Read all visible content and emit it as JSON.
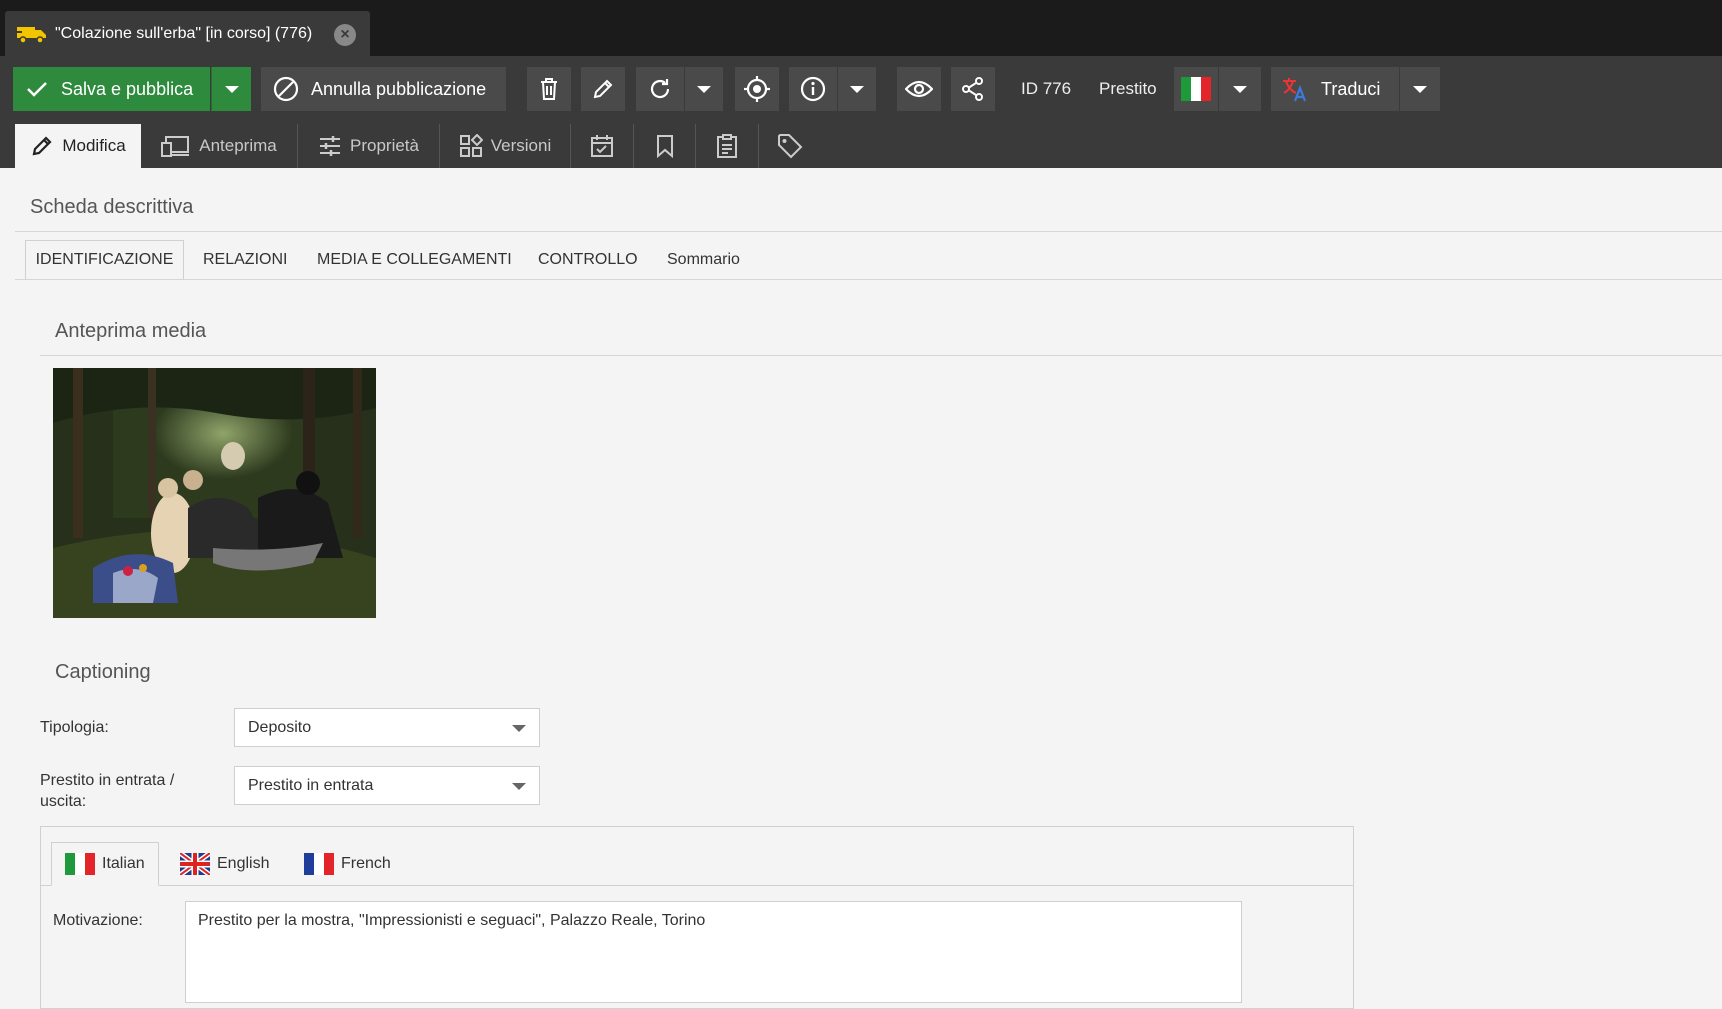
{
  "window": {
    "tab_title": "\"Colazione sull'erba\" [in corso] (776)"
  },
  "toolbar": {
    "save_publish": "Salva e pubblica",
    "unpublish": "Annulla pubblicazione",
    "id_label": "ID 776",
    "status_label": "Prestito",
    "translate": "Traduci"
  },
  "view_tabs": [
    {
      "label": "Modifica",
      "icon": "pencil-icon"
    },
    {
      "label": "Anteprima",
      "icon": "devices-icon"
    },
    {
      "label": "Proprietà",
      "icon": "sliders-icon"
    },
    {
      "label": "Versioni",
      "icon": "versions-icon"
    },
    {
      "label": "",
      "icon": "calendar-check-icon"
    },
    {
      "label": "",
      "icon": "bookmark-icon"
    },
    {
      "label": "",
      "icon": "clipboard-icon"
    },
    {
      "label": "",
      "icon": "tag-icon"
    }
  ],
  "page": {
    "heading": "Scheda descrittiva"
  },
  "sub_tabs": [
    "IDENTIFICAZIONE",
    "RELAZIONI",
    "MEDIA E COLLEGAMENTI",
    "CONTROLLO",
    "Sommario"
  ],
  "media": {
    "section_title": "Anteprima media"
  },
  "captioning": {
    "section_title": "Captioning",
    "tipologia_label": "Tipologia:",
    "tipologia_value": "Deposito",
    "prestito_label": "Prestito in entrata / uscita:",
    "prestito_value": "Prestito in entrata"
  },
  "languages": [
    "Italian",
    "English",
    "French"
  ],
  "motivazione": {
    "label": "Motivazione:",
    "value": "Prestito per la mostra, \"Impressionisti e seguaci\", Palazzo Reale, Torino"
  },
  "colors": {
    "accent_green": "#2e8b3e",
    "dark_bg": "#1b1b1b",
    "toolbar_bg": "#3a3a3a",
    "button_bg": "#4a4a4a"
  }
}
